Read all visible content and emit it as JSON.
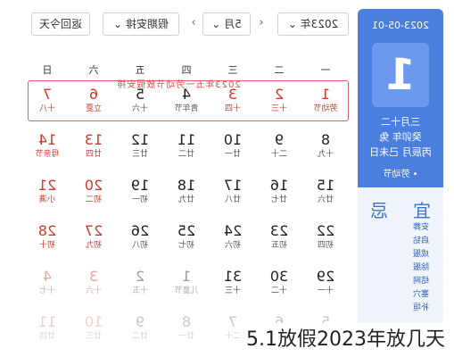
{
  "panel": {
    "date_line": "2023-05-01",
    "day": "1",
    "lunar_lines": [
      "三月十二",
      "癸卯年 兔",
      "丙辰月 己未日"
    ],
    "festival": "• 劳动节",
    "yi_title": "宜",
    "ji_title": "忌",
    "yi_items": [
      "安葬",
      "启钻",
      "成服",
      "除服",
      "结网",
      "塞穴",
      "补垣"
    ]
  },
  "toolbar": {
    "year": "2023年",
    "month": "5月",
    "holiday_select": "假期安排",
    "back_today": "返回今天",
    "prev_arrow": "‹",
    "next_arrow": "›"
  },
  "weekdays": [
    "一",
    "二",
    "三",
    "四",
    "五",
    "六",
    "日"
  ],
  "holiday_banner": "2023年五一劳动节放假安排",
  "rows": [
    [
      {
        "n": "1",
        "s": "劳动节",
        "t": "wk"
      },
      {
        "n": "2",
        "s": "十三",
        "t": "wk"
      },
      {
        "n": "3",
        "s": "十四",
        "t": "wk"
      },
      {
        "n": "4",
        "s": "青年节",
        "t": "n"
      },
      {
        "n": "5",
        "s": "十六",
        "t": "n"
      },
      {
        "n": "6",
        "s": "立夏",
        "t": "wk"
      },
      {
        "n": "7",
        "s": "十八",
        "t": "wk"
      }
    ],
    [
      {
        "n": "8",
        "s": "十九",
        "t": "n"
      },
      {
        "n": "9",
        "s": "二十",
        "t": "n"
      },
      {
        "n": "10",
        "s": "廿一",
        "t": "n"
      },
      {
        "n": "11",
        "s": "廿二",
        "t": "n"
      },
      {
        "n": "12",
        "s": "廿三",
        "t": "n"
      },
      {
        "n": "13",
        "s": "廿四",
        "t": "wk"
      },
      {
        "n": "14",
        "s": "母亲节",
        "t": "wk"
      }
    ],
    [
      {
        "n": "15",
        "s": "廿六",
        "t": "n"
      },
      {
        "n": "16",
        "s": "廿七",
        "t": "n"
      },
      {
        "n": "17",
        "s": "廿八",
        "t": "n"
      },
      {
        "n": "18",
        "s": "廿九",
        "t": "n"
      },
      {
        "n": "19",
        "s": "初一",
        "t": "n"
      },
      {
        "n": "20",
        "s": "初二",
        "t": "wk"
      },
      {
        "n": "21",
        "s": "小满",
        "t": "wk"
      }
    ],
    [
      {
        "n": "22",
        "s": "初四",
        "t": "n"
      },
      {
        "n": "23",
        "s": "初五",
        "t": "n"
      },
      {
        "n": "24",
        "s": "初六",
        "t": "n"
      },
      {
        "n": "25",
        "s": "初七",
        "t": "n"
      },
      {
        "n": "26",
        "s": "初八",
        "t": "n"
      },
      {
        "n": "27",
        "s": "初九",
        "t": "wk"
      },
      {
        "n": "28",
        "s": "初十",
        "t": "wk"
      }
    ],
    [
      {
        "n": "29",
        "s": "十一",
        "t": "n"
      },
      {
        "n": "30",
        "s": "十二",
        "t": "n"
      },
      {
        "n": "31",
        "s": "十三",
        "t": "n"
      },
      {
        "n": "1",
        "s": "儿童节",
        "t": "dim"
      },
      {
        "n": "2",
        "s": "十五",
        "t": "dim"
      },
      {
        "n": "3",
        "s": "十六",
        "t": "dimwk"
      },
      {
        "n": "4",
        "s": "十七",
        "t": "dimwk"
      }
    ],
    [
      {
        "n": "5",
        "s": "十八",
        "t": "fade"
      },
      {
        "n": "6",
        "s": "十九",
        "t": "fade"
      },
      {
        "n": "7",
        "s": "二十",
        "t": "fade"
      },
      {
        "n": "8",
        "s": "廿一",
        "t": "fade"
      },
      {
        "n": "9",
        "s": "廿二",
        "t": "fade"
      },
      {
        "n": "10",
        "s": "廿三",
        "t": "fadewk"
      },
      {
        "n": "11",
        "s": "廿四",
        "t": "fadewk"
      }
    ]
  ],
  "caption": "5.1放假2023年放几天"
}
